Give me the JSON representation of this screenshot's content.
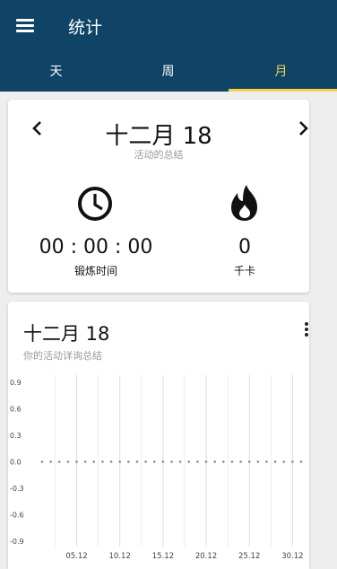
{
  "app": {
    "title": "统计",
    "tabs": [
      {
        "label": "天",
        "active": false
      },
      {
        "label": "周",
        "active": false
      },
      {
        "label": "月",
        "active": true
      }
    ],
    "colors": {
      "header": "#0f4467",
      "accent": "#f6d24b"
    }
  },
  "summary_card": {
    "title": "十二月 18",
    "subtitle": "活动的总结",
    "prev_icon": "chevron-left-icon",
    "next_icon": "chevron-right-icon",
    "duration": {
      "value": "00 : 00 : 00",
      "label": "锻炼时间",
      "icon": "clock-icon"
    },
    "calories": {
      "value": "0",
      "label": "千卡",
      "icon": "fire-icon"
    }
  },
  "detail_card": {
    "title": "十二月 18",
    "subtitle": "你的活动详询总结",
    "menu_icon": "more-vertical-icon"
  },
  "chart_data": {
    "type": "scatter",
    "title": "",
    "xlabel": "",
    "ylabel": "",
    "x_ticks": [
      "05.12",
      "10.12",
      "15.12",
      "20.12",
      "25.12",
      "30.12"
    ],
    "y_ticks": [
      "0.9",
      "0.6",
      "0.3",
      "0.0",
      "-0.3",
      "-0.6",
      "-0.9"
    ],
    "ylim": [
      -0.9,
      0.9
    ],
    "x": [
      1,
      2,
      3,
      4,
      5,
      6,
      7,
      8,
      9,
      10,
      11,
      12,
      13,
      14,
      15,
      16,
      17,
      18,
      19,
      20,
      21,
      22,
      23,
      24,
      25,
      26,
      27,
      28,
      29,
      30,
      31
    ],
    "y": [
      0,
      0,
      0,
      0,
      0,
      0,
      0,
      0,
      0,
      0,
      0,
      0,
      0,
      0,
      0,
      0,
      0,
      0,
      0,
      0,
      0,
      0,
      0,
      0,
      0,
      0,
      0,
      0,
      0,
      0,
      0
    ],
    "grid": true,
    "point_color": "#888888"
  }
}
